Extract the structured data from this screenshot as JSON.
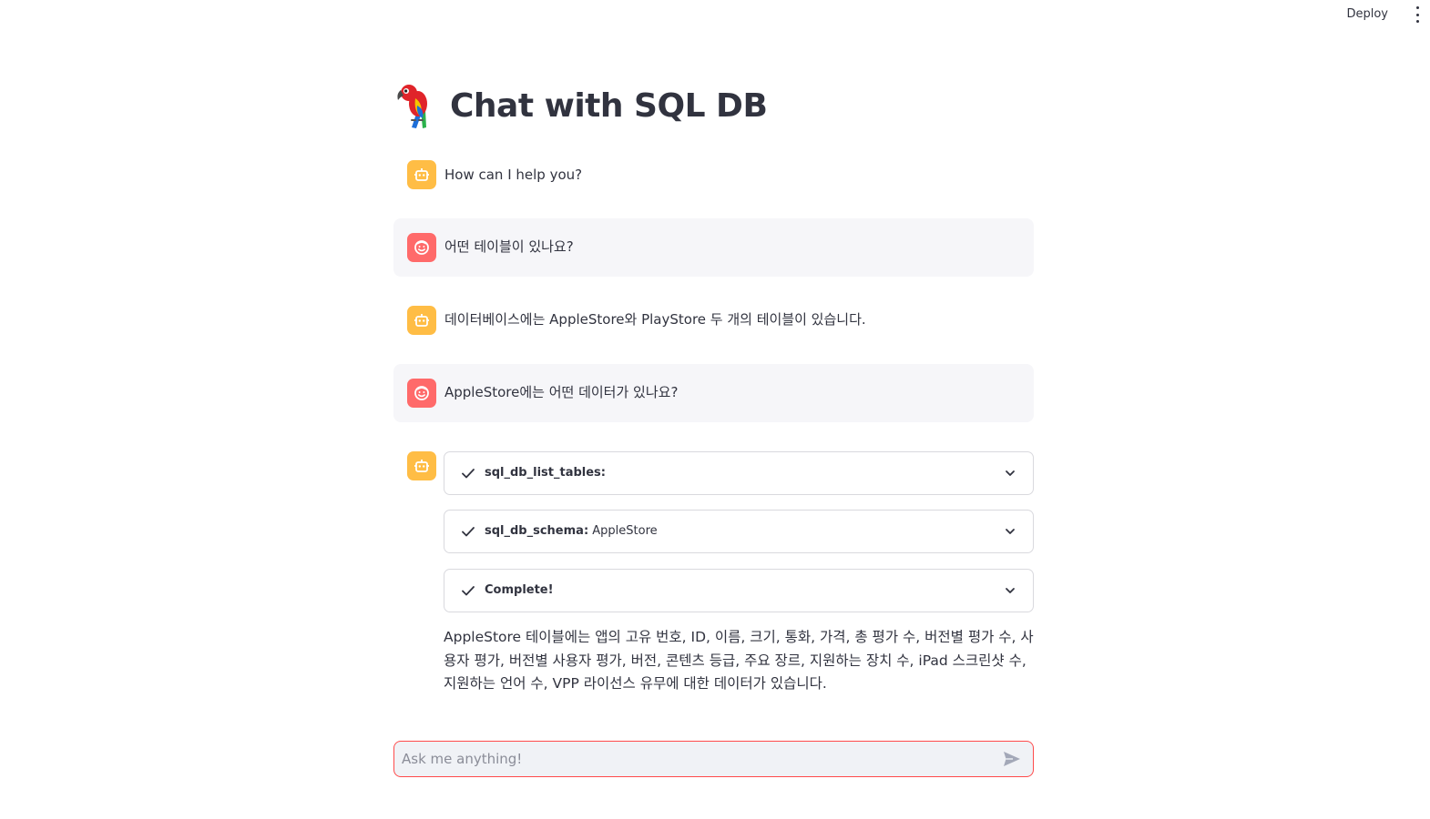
{
  "topbar": {
    "deploy_label": "Deploy",
    "menu_icon": "kebab-menu-icon"
  },
  "header": {
    "icon": "parrot-icon",
    "title": "Chat with SQL DB"
  },
  "messages": [
    {
      "role": "assistant",
      "avatar_icon": "robot-icon",
      "text": "How can I help you?"
    },
    {
      "role": "user",
      "avatar_icon": "smiley-icon",
      "text": "어떤 테이블이 있나요?"
    },
    {
      "role": "assistant",
      "avatar_icon": "robot-icon",
      "text": "데이터베이스에는 AppleStore와 PlayStore 두 개의 테이블이 있습니다."
    },
    {
      "role": "user",
      "avatar_icon": "smiley-icon",
      "text": "AppleStore에는 어떤 데이터가 있나요?"
    },
    {
      "role": "assistant",
      "avatar_icon": "robot-icon",
      "steps": [
        {
          "name": "sql_db_list_tables:",
          "arg": "",
          "status_icon": "check-icon",
          "expand_icon": "chevron-down-icon"
        },
        {
          "name": "sql_db_schema:",
          "arg": " AppleStore",
          "status_icon": "check-icon",
          "expand_icon": "chevron-down-icon"
        },
        {
          "name": "Complete!",
          "arg": "",
          "status_icon": "check-icon",
          "expand_icon": "chevron-down-icon"
        }
      ],
      "text": "AppleStore 테이블에는 앱의 고유 번호, ID, 이름, 크기, 통화, 가격, 총 평가 수, 버전별 평가 수, 사용자 평가, 버전별 사용자 평가, 버전, 콘텐츠 등급, 주요 장르, 지원하는 장치 수, iPad 스크린샷 수, 지원하는 언어 수, VPP 라이선스 유무에 대한 데이터가 있습니다."
    }
  ],
  "chat_input": {
    "placeholder": "Ask me anything!",
    "value": "",
    "send_icon": "send-icon"
  },
  "colors": {
    "assistant_avatar": "#ffbd45",
    "user_avatar": "#ff6a6a",
    "user_bubble": "#f6f6f9",
    "input_border": "#ff4b4b",
    "input_bg": "#f0f2f6",
    "text": "#31333f"
  }
}
